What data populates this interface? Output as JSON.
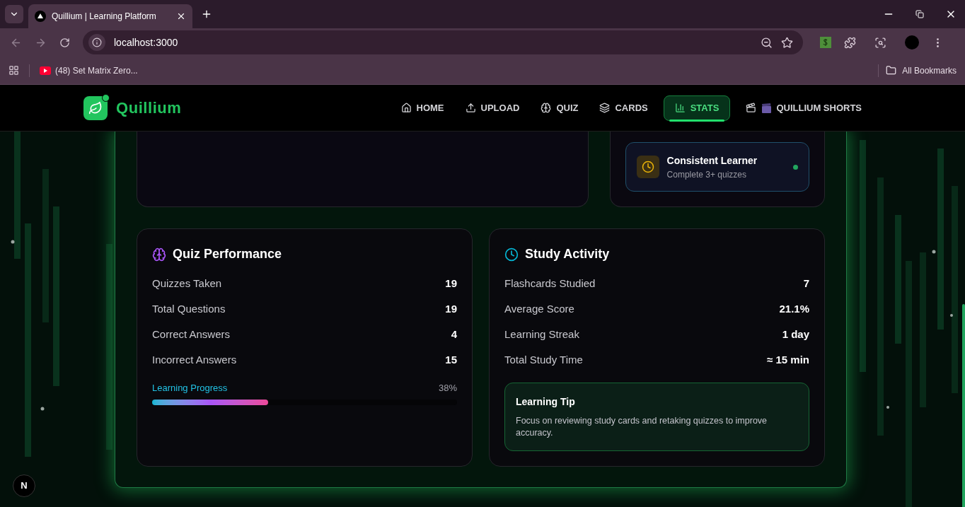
{
  "browser": {
    "tab_title": "Quillium | Learning Platform",
    "url": "localhost:3000",
    "bookmarks": [
      {
        "label": "(48) Set Matrix Zero..."
      }
    ],
    "all_bookmarks": "All Bookmarks"
  },
  "nav": {
    "brand": "Quillium",
    "items": [
      {
        "label": "HOME",
        "kind": "home",
        "selected": false
      },
      {
        "label": "UPLOAD",
        "kind": "upload",
        "selected": false
      },
      {
        "label": "QUIZ",
        "kind": "brain",
        "selected": false
      },
      {
        "label": "CARDS",
        "kind": "layers",
        "selected": false
      },
      {
        "label": "STATS",
        "kind": "chart",
        "selected": true
      },
      {
        "label": "QUILLIUM SHORTS",
        "kind": "shorts",
        "selected": false
      }
    ]
  },
  "achievement": {
    "title": "Consistent Learner",
    "subtitle": "Complete 3+ quizzes",
    "earned": true
  },
  "quiz_performance": {
    "title": "Quiz Performance",
    "rows": [
      {
        "label": "Quizzes Taken",
        "value": "19"
      },
      {
        "label": "Total Questions",
        "value": "19"
      },
      {
        "label": "Correct Answers",
        "value": "4"
      },
      {
        "label": "Incorrect Answers",
        "value": "15"
      }
    ],
    "progress": {
      "label": "Learning Progress",
      "reading": "38%",
      "level": 0.38
    }
  },
  "study_activity": {
    "title": "Study Activity",
    "rows": [
      {
        "label": "Flashcards Studied",
        "value": "7"
      },
      {
        "label": "Average Score",
        "value": "21.1%"
      },
      {
        "label": "Learning Streak",
        "value": "1 day"
      },
      {
        "label": "Total Study Time",
        "value": "≈ 15 min"
      }
    ],
    "tip": {
      "title": "Learning Tip",
      "text": "Focus on reviewing study cards and retaking quizzes to improve accuracy."
    }
  },
  "dev_indicator": "N"
}
